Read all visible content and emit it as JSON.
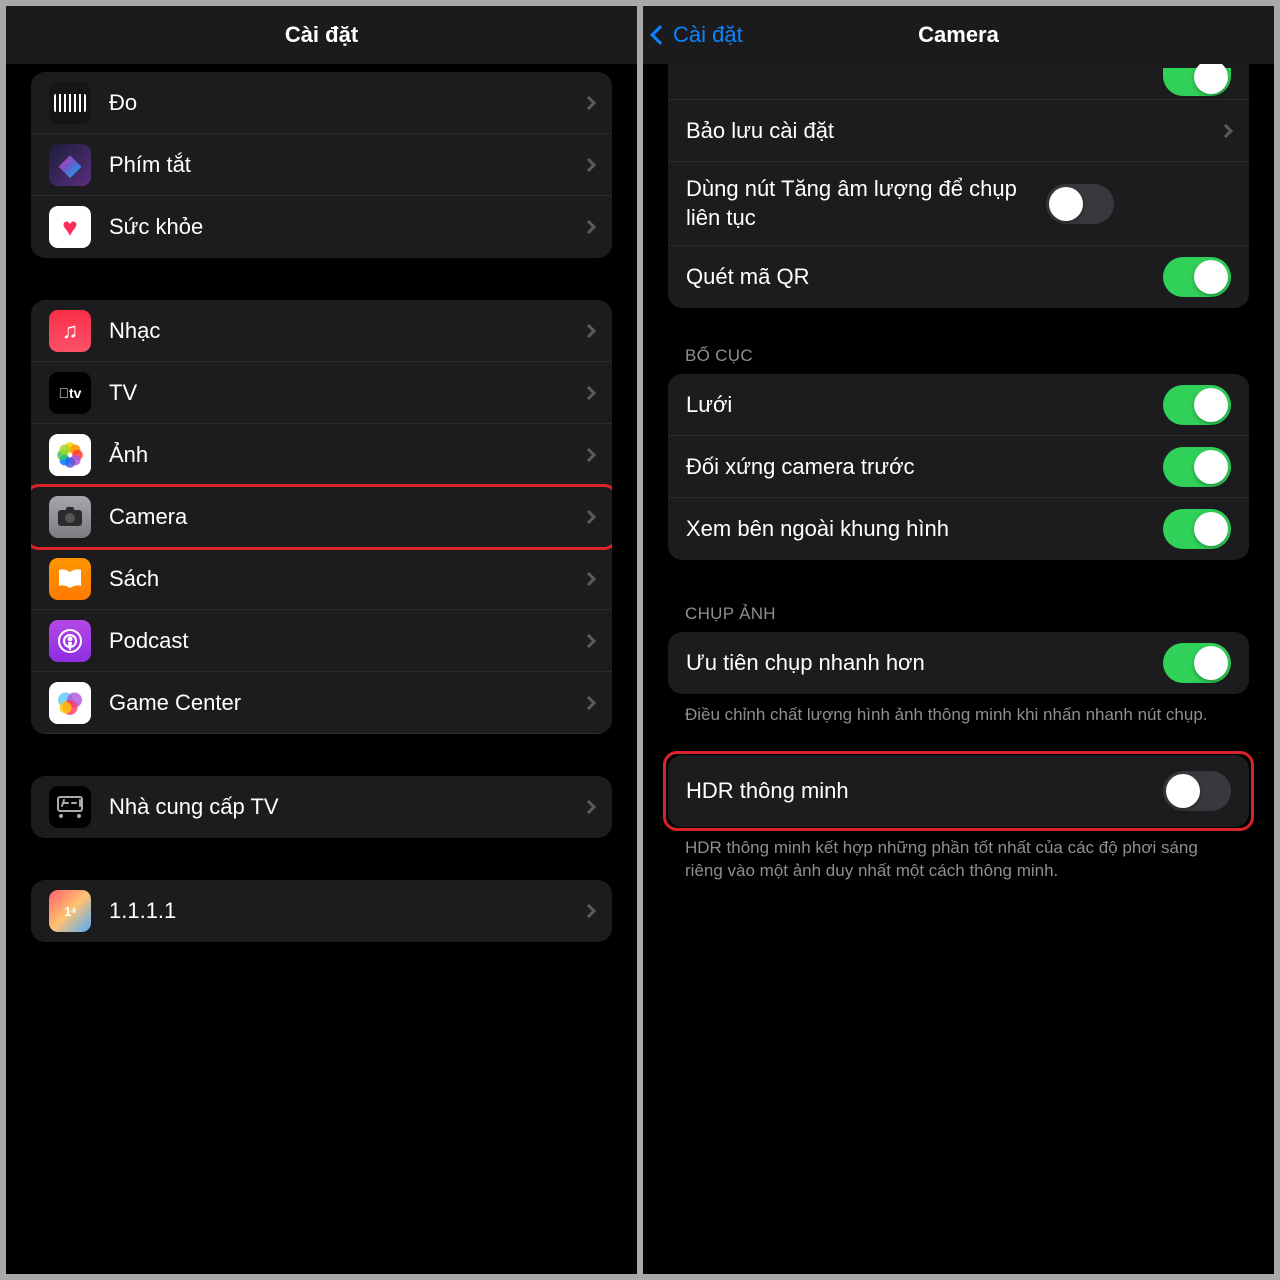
{
  "left": {
    "title": "Cài đặt",
    "group1": [
      {
        "label": "Đo",
        "icon": "measure-icon"
      },
      {
        "label": "Phím tắt",
        "icon": "shortcuts-icon"
      },
      {
        "label": "Sức khỏe",
        "icon": "health-icon"
      }
    ],
    "group2": [
      {
        "label": "Nhạc",
        "icon": "music-icon"
      },
      {
        "label": "TV",
        "icon": "tv-icon"
      },
      {
        "label": "Ảnh",
        "icon": "photos-icon"
      },
      {
        "label": "Camera",
        "icon": "camera-icon",
        "highlighted": true
      },
      {
        "label": "Sách",
        "icon": "books-icon"
      },
      {
        "label": "Podcast",
        "icon": "podcast-icon"
      },
      {
        "label": "Game Center",
        "icon": "gamecenter-icon"
      }
    ],
    "group3": [
      {
        "label": "Nhà cung cấp TV",
        "icon": "tvprovider-icon"
      }
    ],
    "group4": [
      {
        "label": "1.1.1.1",
        "icon": "cloudflare-icon"
      }
    ]
  },
  "right": {
    "back": "Cài đặt",
    "title": "Camera",
    "top_rows": [
      {
        "type": "toggle_partial_on"
      },
      {
        "label": "Bảo lưu cài đặt",
        "type": "chevron"
      },
      {
        "label": "Dùng nút Tăng âm lượng để chụp liên tục",
        "type": "toggle",
        "on": false
      },
      {
        "label": "Quét mã QR",
        "type": "toggle",
        "on": true
      }
    ],
    "section_layout": "BỐ CỤC",
    "layout_rows": [
      {
        "label": "Lưới",
        "on": true
      },
      {
        "label": "Đối xứng camera trước",
        "on": true
      },
      {
        "label": "Xem bên ngoài khung hình",
        "on": true
      }
    ],
    "section_capture": "CHỤP ẢNH",
    "capture_rows": [
      {
        "label": "Ưu tiên chụp nhanh hơn",
        "on": true
      }
    ],
    "capture_footer": "Điều chỉnh chất lượng hình ảnh thông minh khi nhấn nhanh nút chụp.",
    "hdr_row": {
      "label": "HDR thông minh",
      "on": false,
      "highlighted": true
    },
    "hdr_footer": "HDR thông minh kết hợp những phần tốt nhất của các độ phơi sáng riêng vào một ảnh duy nhất một cách thông minh."
  }
}
